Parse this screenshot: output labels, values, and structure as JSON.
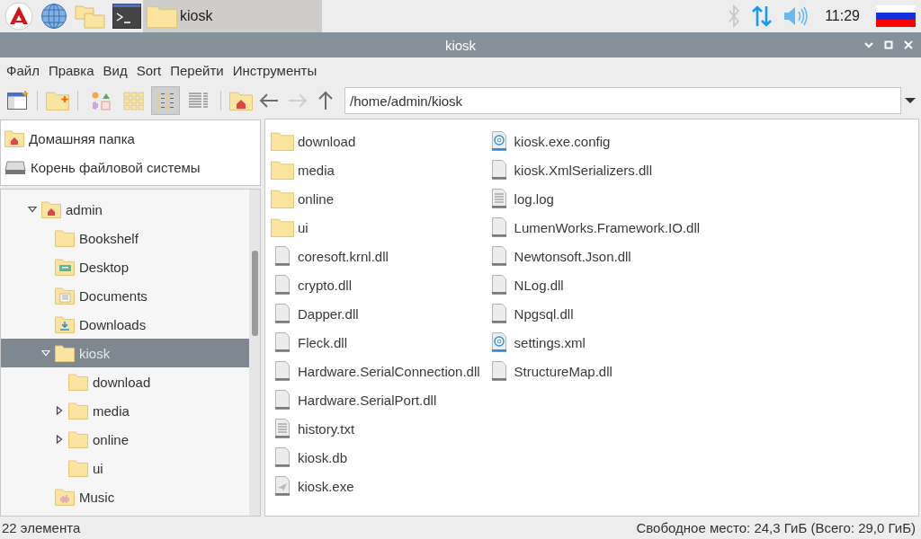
{
  "taskbar": {
    "windows": [
      {
        "title": "kiosk",
        "selected": true
      }
    ],
    "clock": "11:29"
  },
  "window": {
    "title": "kiosk"
  },
  "menu": [
    "Файл",
    "Правка",
    "Вид",
    "Sort",
    "Перейти",
    "Инструменты"
  ],
  "toolbar": {
    "views": [
      {
        "kind": "thumbnail",
        "selected": false
      },
      {
        "kind": "icon",
        "selected": false
      },
      {
        "kind": "compact",
        "selected": true
      },
      {
        "kind": "list",
        "selected": false
      }
    ],
    "nav": [
      {
        "kind": "back",
        "disabled": false
      },
      {
        "kind": "forward",
        "disabled": true
      },
      {
        "kind": "up",
        "disabled": false
      }
    ],
    "path": "/home/admin/kiosk"
  },
  "places": [
    {
      "kind": "home",
      "label": "Домашняя папка"
    },
    {
      "kind": "drive",
      "label": "Корень файловой системы"
    }
  ],
  "tree": [
    {
      "kind": "home",
      "label": "admin",
      "expanded": true,
      "selected": false,
      "children": [
        {
          "kind": "folder",
          "label": "Bookshelf",
          "selected": false
        },
        {
          "kind": "desktop",
          "label": "Desktop",
          "selected": false
        },
        {
          "kind": "documents",
          "label": "Documents",
          "selected": false
        },
        {
          "kind": "downloads",
          "label": "Downloads",
          "selected": false
        },
        {
          "kind": "folder",
          "label": "kiosk",
          "expanded": true,
          "selected": true,
          "children": [
            {
              "kind": "folder",
              "label": "download",
              "selected": false
            },
            {
              "kind": "folder",
              "label": "media",
              "expanded": false,
              "selected": false
            },
            {
              "kind": "folder",
              "label": "online",
              "expanded": false,
              "selected": false
            },
            {
              "kind": "folder",
              "label": "ui",
              "selected": false
            }
          ]
        },
        {
          "kind": "music",
          "label": "Music",
          "selected": false
        }
      ]
    }
  ],
  "files": [
    {
      "kind": "folder",
      "name": "download"
    },
    {
      "kind": "folder",
      "name": "media"
    },
    {
      "kind": "folder",
      "name": "online"
    },
    {
      "kind": "folder",
      "name": "ui"
    },
    {
      "kind": "binary",
      "name": "coresoft.krnl.dll"
    },
    {
      "kind": "binary",
      "name": "crypto.dll"
    },
    {
      "kind": "binary",
      "name": "Dapper.dll"
    },
    {
      "kind": "binary",
      "name": "Fleck.dll"
    },
    {
      "kind": "binary",
      "name": "Hardware.SerialConnection.dll"
    },
    {
      "kind": "binary",
      "name": "Hardware.SerialPort.dll"
    },
    {
      "kind": "text",
      "name": "history.txt"
    },
    {
      "kind": "binary",
      "name": "kiosk.db"
    },
    {
      "kind": "executable",
      "name": "kiosk.exe"
    },
    {
      "kind": "web",
      "name": "kiosk.exe.config"
    },
    {
      "kind": "binary",
      "name": "kiosk.XmlSerializers.dll"
    },
    {
      "kind": "text",
      "name": "log.log"
    },
    {
      "kind": "binary",
      "name": "LumenWorks.Framework.IO.dll"
    },
    {
      "kind": "binary",
      "name": "Newtonsoft.Json.dll"
    },
    {
      "kind": "binary",
      "name": "NLog.dll"
    },
    {
      "kind": "binary",
      "name": "Npgsql.dll"
    },
    {
      "kind": "web",
      "name": "settings.xml"
    },
    {
      "kind": "binary",
      "name": "StructureMap.dll"
    }
  ],
  "status_bar": {
    "count": "22 элемента",
    "free_space": "Свободное место: 24,3 ГиБ (Всего: 29,0 ГиБ)"
  }
}
